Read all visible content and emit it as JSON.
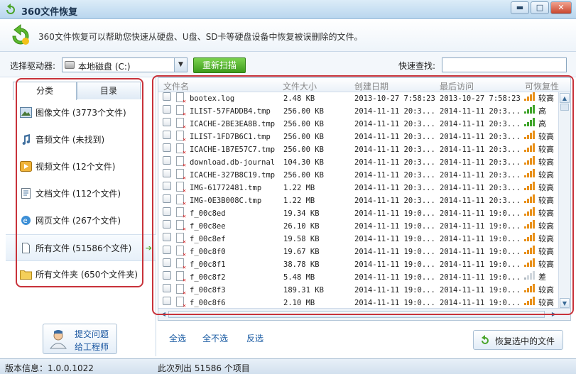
{
  "window": {
    "title": "360文件恢复",
    "description": "360文件恢复可以帮助您快速从硬盘、U盘、SD卡等硬盘设备中恢复被误删除的文件。",
    "buttons": {
      "minimize": "▬",
      "maximize": "□",
      "close": "✕"
    }
  },
  "drive_bar": {
    "select_label": "选择驱动器:",
    "drive_value": "本地磁盘 (C:)",
    "rescan_label": "重新扫描",
    "quick_search_label": "快速查找:",
    "quick_search_value": ""
  },
  "left_panel": {
    "tabs": [
      {
        "label": "分类",
        "active": true
      },
      {
        "label": "目录",
        "active": false
      }
    ],
    "categories": [
      {
        "label": "图像文件 (3773个文件)",
        "icon": "image-icon"
      },
      {
        "label": "音频文件 (未找到)",
        "icon": "music-icon"
      },
      {
        "label": "视频文件 (12个文件)",
        "icon": "video-icon"
      },
      {
        "label": "文档文件 (112个文件)",
        "icon": "document-icon"
      },
      {
        "label": "网页文件 (267个文件)",
        "icon": "web-page-icon"
      },
      {
        "label": "所有文件 (51586个文件)",
        "icon": "file-icon",
        "selected": true
      },
      {
        "label": "所有文件夹 (650个文件夹)",
        "icon": "folder-icon"
      }
    ],
    "engineer": {
      "line1": "提交问题",
      "line2": "给工程师"
    }
  },
  "table": {
    "columns": [
      "文件名",
      "文件大小",
      "创建日期",
      "最后访问",
      "可恢复性"
    ],
    "rows": [
      {
        "name": "bootex.log",
        "size": "2.48 KB",
        "created": "2013-10-27 7:58:23",
        "accessed": "2013-10-27 7:58:23",
        "recoverability": "较高",
        "level": 4
      },
      {
        "name": "ILIST-57FADDB4.tmp",
        "size": "256.00 KB",
        "created": "2014-11-11 20:3...",
        "accessed": "2014-11-11 20:3...",
        "recoverability": "高",
        "level": 5
      },
      {
        "name": "ICACHE-2BE3EA8B.tmp",
        "size": "256.00 KB",
        "created": "2014-11-11 20:3...",
        "accessed": "2014-11-11 20:3...",
        "recoverability": "高",
        "level": 5
      },
      {
        "name": "ILIST-1FD7B6C1.tmp",
        "size": "256.00 KB",
        "created": "2014-11-11 20:3...",
        "accessed": "2014-11-11 20:3...",
        "recoverability": "较高",
        "level": 4
      },
      {
        "name": "ICACHE-1B7E57C7.tmp",
        "size": "256.00 KB",
        "created": "2014-11-11 20:3...",
        "accessed": "2014-11-11 20:3...",
        "recoverability": "较高",
        "level": 4
      },
      {
        "name": "download.db-journal",
        "size": "104.30 KB",
        "created": "2014-11-11 20:3...",
        "accessed": "2014-11-11 20:3...",
        "recoverability": "较高",
        "level": 4
      },
      {
        "name": "ICACHE-327B8C19.tmp",
        "size": "256.00 KB",
        "created": "2014-11-11 20:3...",
        "accessed": "2014-11-11 20:3...",
        "recoverability": "较高",
        "level": 4
      },
      {
        "name": "IMG-61772481.tmp",
        "size": "1.22 MB",
        "created": "2014-11-11 20:3...",
        "accessed": "2014-11-11 20:3...",
        "recoverability": "较高",
        "level": 4
      },
      {
        "name": "IMG-0E3B008C.tmp",
        "size": "1.22 MB",
        "created": "2014-11-11 20:3...",
        "accessed": "2014-11-11 20:3...",
        "recoverability": "较高",
        "level": 4
      },
      {
        "name": "f_00c8ed",
        "size": "19.34 KB",
        "created": "2014-11-11 19:0...",
        "accessed": "2014-11-11 19:0...",
        "recoverability": "较高",
        "level": 4
      },
      {
        "name": "f_00c8ee",
        "size": "26.10 KB",
        "created": "2014-11-11 19:0...",
        "accessed": "2014-11-11 19:0...",
        "recoverability": "较高",
        "level": 4
      },
      {
        "name": "f_00c8ef",
        "size": "19.58 KB",
        "created": "2014-11-11 19:0...",
        "accessed": "2014-11-11 19:0...",
        "recoverability": "较高",
        "level": 4
      },
      {
        "name": "f_00c8f0",
        "size": "19.67 KB",
        "created": "2014-11-11 19:0...",
        "accessed": "2014-11-11 19:0...",
        "recoverability": "较高",
        "level": 4
      },
      {
        "name": "f_00c8f1",
        "size": "38.78 KB",
        "created": "2014-11-11 19:0...",
        "accessed": "2014-11-11 19:0...",
        "recoverability": "较高",
        "level": 4
      },
      {
        "name": "f_00c8f2",
        "size": "5.48 MB",
        "created": "2014-11-11 19:0...",
        "accessed": "2014-11-11 19:0...",
        "recoverability": "差",
        "level": 1
      },
      {
        "name": "f_00c8f3",
        "size": "189.31 KB",
        "created": "2014-11-11 19:0...",
        "accessed": "2014-11-11 19:0...",
        "recoverability": "较高",
        "level": 4
      },
      {
        "name": "f_00c8f6",
        "size": "2.10 MB",
        "created": "2014-11-11 19:0...",
        "accessed": "2014-11-11 19:0...",
        "recoverability": "较高",
        "level": 4
      }
    ]
  },
  "actions": {
    "select_all": "全选",
    "select_none": "全不选",
    "invert": "反选",
    "restore": "恢复选中的文件"
  },
  "status": {
    "version": "版本信息：1.0.0.1022",
    "count": "此次列出 51586 个项目"
  },
  "colors": {
    "accent": "#4a9a1f",
    "signal_high": "#3fa42a",
    "signal_medium": "#e8901a",
    "outline": "#c8323a"
  }
}
